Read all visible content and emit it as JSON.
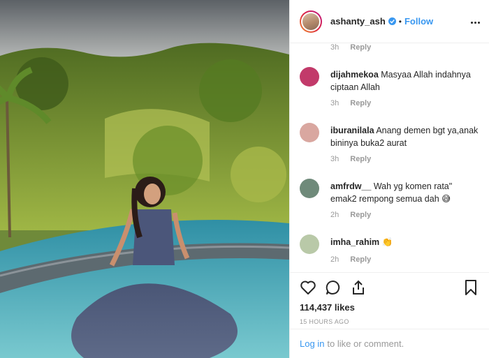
{
  "post": {
    "username": "ashanty_ash",
    "separator": "•",
    "follow_label": "Follow",
    "photo_alt_icon": "photo"
  },
  "comments": [
    {
      "username": "",
      "text": "",
      "time": "3h",
      "reply": "Reply",
      "avatar_color": ""
    },
    {
      "username": "dijahmekoa",
      "text": "Masyaa Allah indahnya ciptaan Allah",
      "time": "3h",
      "reply": "Reply",
      "avatar_color": "#c23a6a"
    },
    {
      "username": "iburanilala",
      "text": "Anang demen bgt ya,anak bininya buka2 aurat",
      "time": "3h",
      "reply": "Reply",
      "avatar_color": "#d9a7a0"
    },
    {
      "username": "amfrdw__",
      "text": "Wah yg komen rata\" emak2 rempong semua dah 😅",
      "time": "2h",
      "reply": "Reply",
      "avatar_color": "#6f8a7a"
    },
    {
      "username": "imha_rahim",
      "text": "👏",
      "time": "2h",
      "reply": "Reply",
      "avatar_color": "#b9c9a8"
    }
  ],
  "actions": {
    "likes": "114,437 likes",
    "posted": "15 HOURS AGO"
  },
  "footer": {
    "login_link": "Log in",
    "login_text": "to like or comment."
  },
  "colors": {
    "link": "#3897f0",
    "muted": "#999999",
    "text": "#262626"
  }
}
